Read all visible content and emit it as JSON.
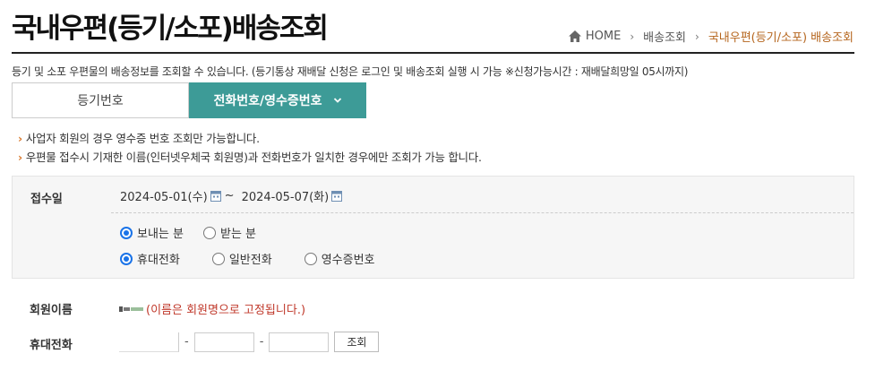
{
  "page": {
    "title": "국내우편(등기/소포)배송조회",
    "description": "등기 및 소포 우편물의 배송정보를 조회할 수 있습니다. (등기통상 재배달 신청은 로그인 및 배송조회 실행 시 가능 ※신청가능시간 : 재배달희망일 05시까지)"
  },
  "breadcrumb": {
    "home": "HOME",
    "level1": "배송조회",
    "current": "국내우편(등기/소포) 배송조회"
  },
  "tabs": {
    "tab1": "등기번호",
    "tab2": "전화번호/영수증번호"
  },
  "notes": [
    "사업자 회원의 경우 영수증 번호 조회만 가능합니다.",
    "우편물 접수시 기재한 이름(인터넷우체국 회원명)과 전화번호가 일치한 경우에만 조회가 가능 합니다."
  ],
  "search": {
    "date_label": "접수일",
    "date_from": "2024-05-01(수)",
    "date_sep": "~",
    "date_to": "2024-05-07(화)",
    "direction_options": [
      "보내는 분",
      "받는 분"
    ],
    "direction_selected": "보내는 분",
    "phone_type_options": [
      "휴대전화",
      "일반전화",
      "영수증번호"
    ],
    "phone_type_selected": "휴대전화"
  },
  "form": {
    "member_label": "회원이름",
    "member_note": "(이름은 회원명으로 고정됩니다.)",
    "phone_label": "휴대전화",
    "phone_sep": "-",
    "search_button": "조회"
  },
  "colors": {
    "accent": "#3d9b97",
    "breadcrumb_current": "#b5651d",
    "bullet": "#d9772a",
    "warning": "#c0392b"
  }
}
